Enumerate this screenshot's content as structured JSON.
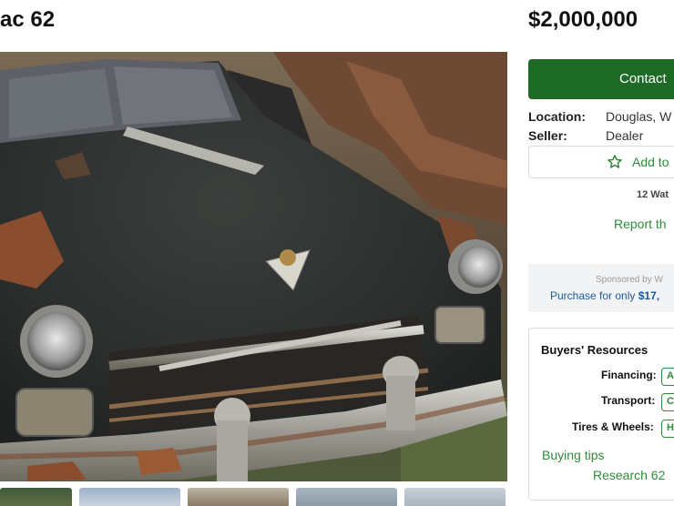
{
  "listing": {
    "title": "ac 62",
    "price": "$2,000,000"
  },
  "contact": {
    "button_label": "Contact"
  },
  "details": {
    "location_label": "Location:",
    "location_value": "Douglas, W",
    "seller_label": "Seller:",
    "seller_value": "Dealer"
  },
  "watch": {
    "star_icon": "star-outline-icon",
    "label": "Add to",
    "watchers": "12 Wat"
  },
  "report": {
    "label": "Report th"
  },
  "sponsor": {
    "note": "Sponsored by W",
    "link_prefix": "Purchase for only ",
    "link_amount": "$17,"
  },
  "resources": {
    "title": "Buyers' Resources",
    "items": [
      {
        "label": "Financing:",
        "chip": "A"
      },
      {
        "label": "Transport:",
        "chip": "C"
      },
      {
        "label": "Tires & Wheels:",
        "chip": "H"
      }
    ],
    "buying_tips": "Buying tips",
    "research": "Research 62"
  },
  "colors": {
    "brand_green": "#1e6b28",
    "link_green": "#2e8b3a",
    "link_blue": "#1a5a9c"
  }
}
